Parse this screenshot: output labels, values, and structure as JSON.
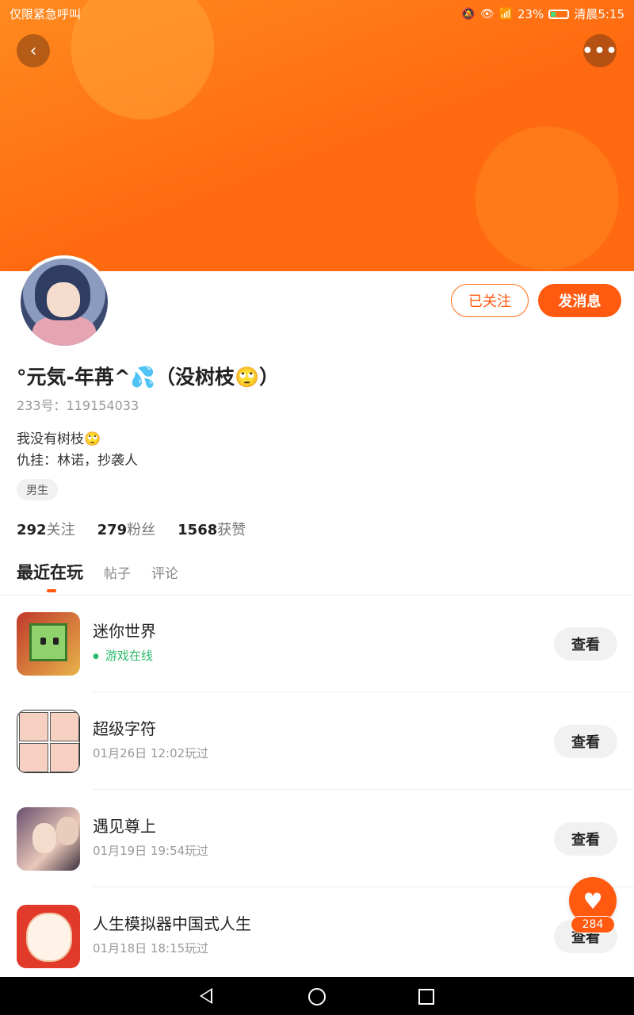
{
  "status_bar": {
    "left_text": "仅限紧急呼叫",
    "battery": "23%",
    "time": "清晨5:15"
  },
  "header": {
    "back_icon": "back-arrow-icon",
    "more_icon": "more-dots-icon",
    "colors": {
      "banner": "#ff6a10",
      "accent": "#ff5a10"
    }
  },
  "profile": {
    "username": "°元気-年苒^💦（没树枝🙄）",
    "id_text": "233号：119154033",
    "bio_line1": "我没有树枝🙄",
    "bio_line2": "仇挂：林诺，抄袭人",
    "tag": "男生",
    "follow_button": "已关注",
    "message_button": "发消息",
    "stats": [
      {
        "num": "292",
        "label": "关注"
      },
      {
        "num": "279",
        "label": "粉丝"
      },
      {
        "num": "1568",
        "label": "获赞"
      }
    ]
  },
  "tabs": [
    {
      "label": "最近在玩",
      "active": true
    },
    {
      "label": "帖子",
      "active": false
    },
    {
      "label": "评论",
      "active": false
    }
  ],
  "games": [
    {
      "name": "迷你世界",
      "sub": "游戏在线",
      "online": true,
      "button": "查看"
    },
    {
      "name": "超级字符",
      "sub": "01月26日 12:02玩过",
      "online": false,
      "button": "查看"
    },
    {
      "name": "遇见尊上",
      "sub": "01月19日 19:54玩过",
      "online": false,
      "button": "查看"
    },
    {
      "name": "人生模拟器中国式人生",
      "sub": "01月18日 18:15玩过",
      "online": false,
      "button": "查看"
    }
  ],
  "fab": {
    "icon": "heart-icon",
    "count": "284"
  }
}
